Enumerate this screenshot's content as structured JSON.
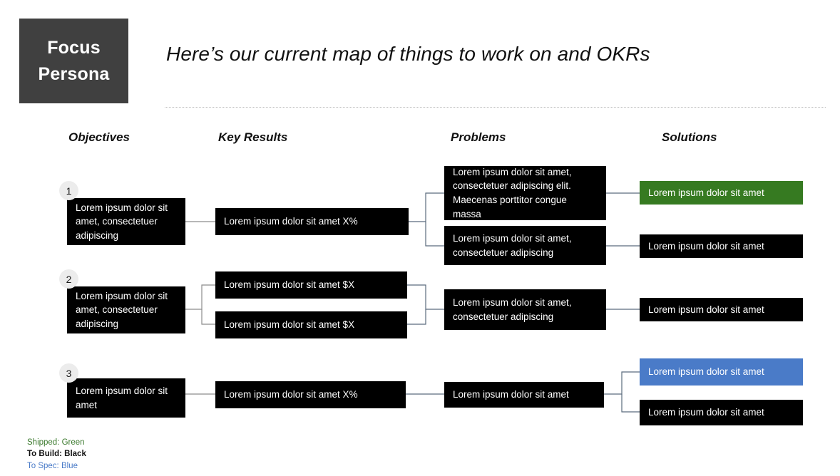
{
  "header": {
    "persona_line1": "Focus",
    "persona_line2": "Persona",
    "title": "Here’s our current map of things to work on and OKRs"
  },
  "columns": [
    {
      "label": "Objectives"
    },
    {
      "label": "Key Results"
    },
    {
      "label": "Problems"
    },
    {
      "label": "Solutions"
    }
  ],
  "rows": [
    {
      "number": "1",
      "objectives": [
        {
          "text": "Lorem ipsum dolor sit amet, consectetuer adipiscing",
          "color": "black"
        }
      ],
      "key_results": [
        {
          "text": "Lorem ipsum dolor sit amet X%",
          "color": "black"
        }
      ],
      "problems": [
        {
          "text": "Lorem ipsum dolor sit amet, consectetuer adipiscing elit. Maecenas porttitor congue massa",
          "color": "black"
        },
        {
          "text": "Lorem ipsum dolor sit amet, consectetuer adipiscing",
          "color": "black"
        }
      ],
      "solutions": [
        {
          "text": "Lorem ipsum dolor sit amet",
          "color": "green"
        },
        {
          "text": "Lorem ipsum dolor sit amet",
          "color": "black"
        }
      ]
    },
    {
      "number": "2",
      "objectives": [
        {
          "text": "Lorem ipsum dolor sit amet, consectetuer adipiscing",
          "color": "black"
        }
      ],
      "key_results": [
        {
          "text": "Lorem ipsum dolor sit amet $X",
          "color": "black"
        },
        {
          "text": "Lorem ipsum dolor sit amet $X",
          "color": "black"
        }
      ],
      "problems": [
        {
          "text": "Lorem ipsum dolor sit amet, consectetuer adipiscing",
          "color": "black"
        }
      ],
      "solutions": [
        {
          "text": "Lorem ipsum dolor sit amet",
          "color": "black"
        }
      ]
    },
    {
      "number": "3",
      "objectives": [
        {
          "text": "Lorem ipsum dolor sit amet",
          "color": "black"
        }
      ],
      "key_results": [
        {
          "text": "Lorem ipsum dolor sit amet X%",
          "color": "black"
        }
      ],
      "problems": [
        {
          "text": "Lorem ipsum dolor sit amet",
          "color": "black"
        }
      ],
      "solutions": [
        {
          "text": "Lorem ipsum dolor sit amet",
          "color": "blue"
        },
        {
          "text": "Lorem ipsum dolor sit amet",
          "color": "black"
        }
      ]
    }
  ],
  "legend": {
    "shipped": "Shipped: Green",
    "to_build": "To Build: Black",
    "to_spec": "To Spec: Blue"
  },
  "colors": {
    "persona_bg": "#404040",
    "box_black": "#000000",
    "box_green": "#367A21",
    "box_blue": "#4A7BC8",
    "connector": "#5b6b7d",
    "circle_bg": "#ececec"
  }
}
